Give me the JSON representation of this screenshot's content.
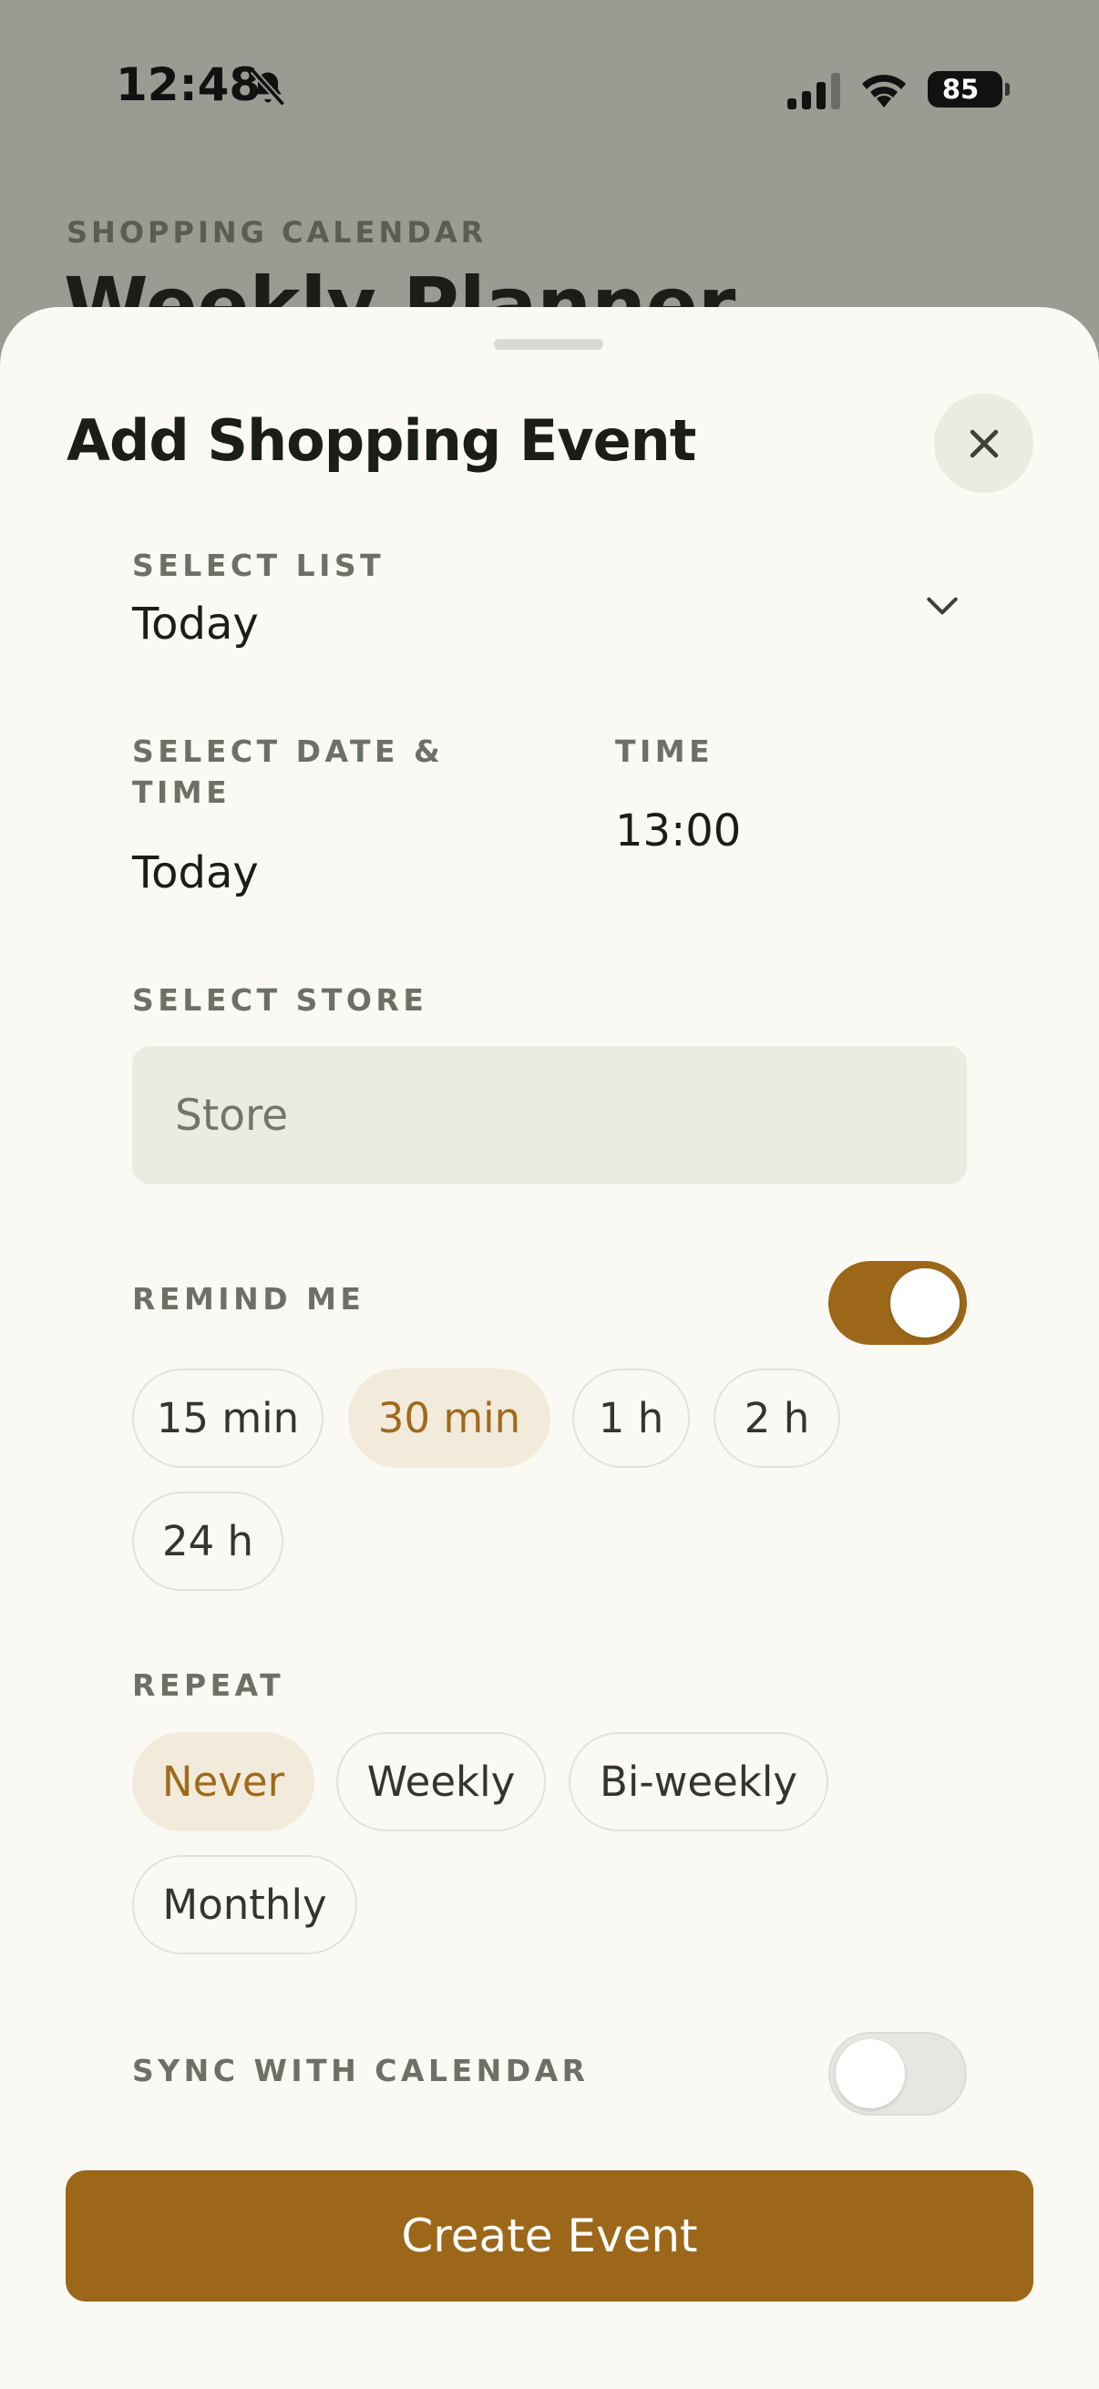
{
  "status_bar": {
    "time": "12:48",
    "battery": "85"
  },
  "background": {
    "eyebrow": "SHOPPING CALENDAR",
    "title": "Weekly Planner"
  },
  "sheet": {
    "title": "Add Shopping Event",
    "list": {
      "label": "SELECT LIST",
      "value": "Today"
    },
    "date": {
      "label_line1": "SELECT DATE &",
      "label_line2": "TIME",
      "value": "Today"
    },
    "time": {
      "label": "TIME",
      "value": "13:00"
    },
    "store": {
      "label": "SELECT STORE",
      "placeholder": "Store",
      "value": ""
    },
    "remind": {
      "label": "REMIND ME",
      "enabled": true,
      "options": [
        "15 min",
        "30 min",
        "1 h",
        "2 h",
        "24 h"
      ],
      "selected": "30 min"
    },
    "repeat": {
      "label": "REPEAT",
      "options": [
        "Never",
        "Weekly",
        "Bi-weekly",
        "Monthly"
      ],
      "selected": "Never"
    },
    "sync": {
      "label": "SYNC WITH CALENDAR",
      "enabled": false
    },
    "create_label": "Create Event"
  },
  "colors": {
    "accent": "#9c6718",
    "chip_selected_bg": "#f2ebdc",
    "input_bg": "#e9ecdf",
    "sheet_bg": "#fbf9f3"
  },
  "icons": [
    "bell-slash-icon",
    "signal-icon",
    "wifi-icon",
    "battery-icon",
    "close-icon",
    "chevron-down-icon"
  ]
}
